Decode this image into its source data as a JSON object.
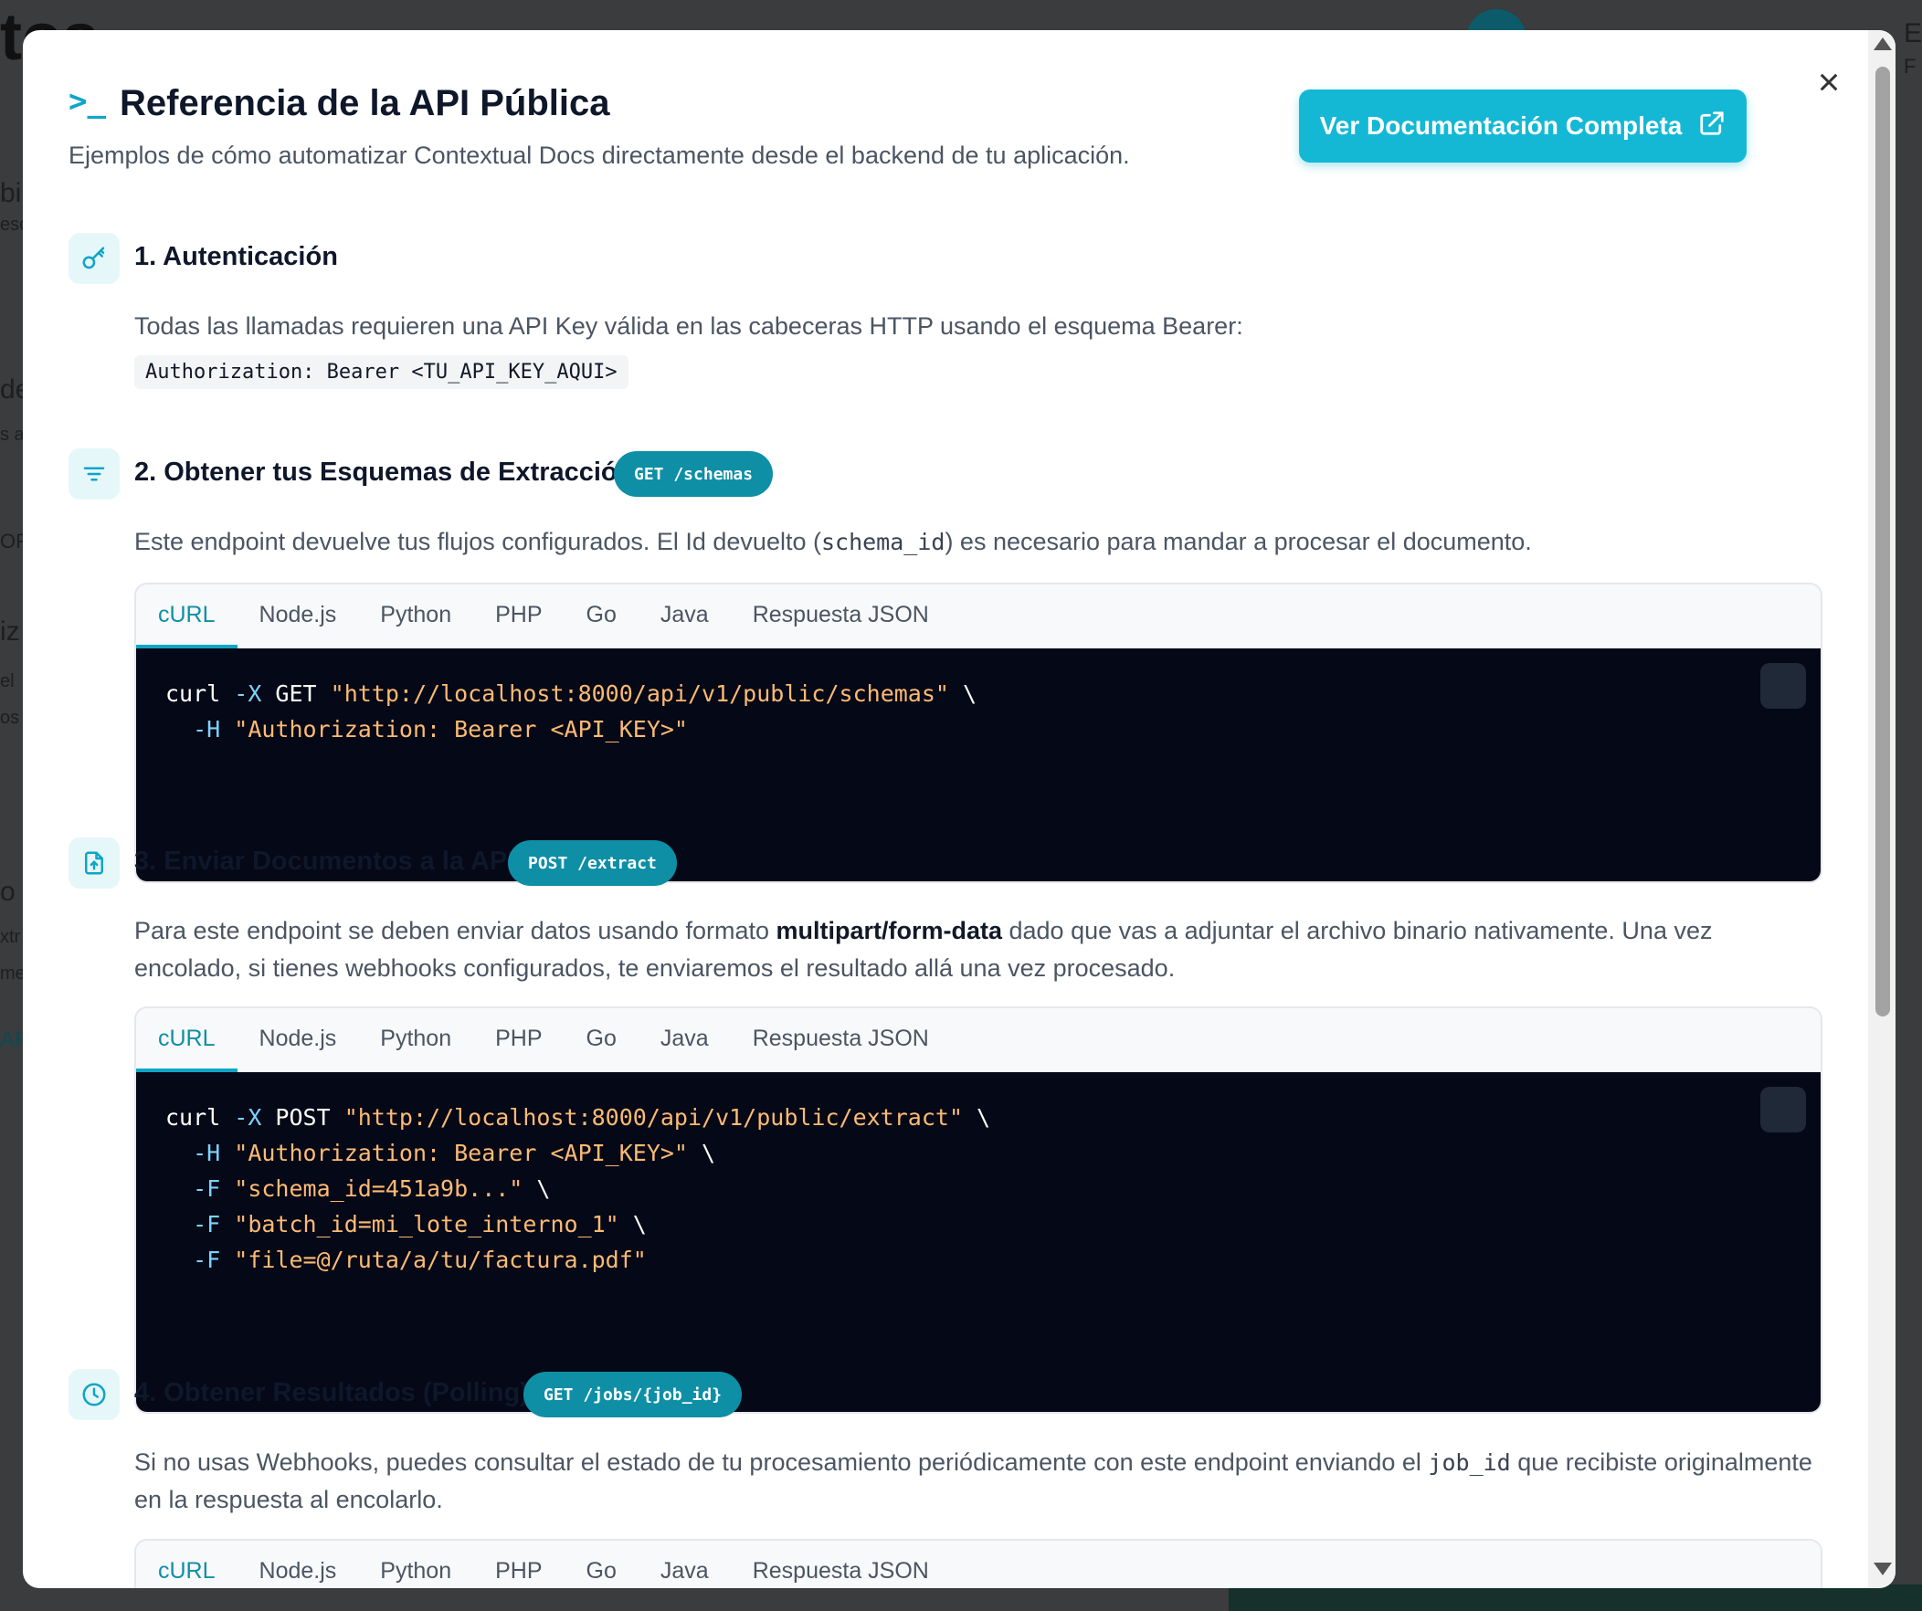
{
  "background": {
    "logo_fragment": "tos",
    "right_fragments": [
      "E",
      "F"
    ],
    "left_fragments": [
      "bir",
      "esc",
      "de",
      "s a",
      "OR",
      "iz",
      "el",
      "os",
      "o",
      "xtr",
      "me",
      "AP"
    ]
  },
  "modal": {
    "title": "Referencia de la API Pública",
    "subtitle": "Ejemplos de cómo automatizar Contextual Docs directamente desde el backend de tu aplicación.",
    "doc_button_label": "Ver Documentación Completa",
    "close_label": "×",
    "header_icon": "terminal-icon",
    "accent_color": "#14b8d4"
  },
  "sections": [
    {
      "title": "1. Autenticación",
      "icon": "key-icon",
      "description": "Todas las llamadas requieren una API Key válida en las cabeceras HTTP usando el esquema Bearer:",
      "code_inline": "Authorization: Bearer <TU_API_KEY_AQUI>"
    },
    {
      "title": "2. Obtener tus Esquemas de Extracción",
      "icon": "filter-icon",
      "badge": "GET /schemas",
      "desc_parts": [
        "Este endpoint devuelve tus flujos configurados. El Id devuelto (",
        "schema_id",
        ") es necesario para mandar a procesar el documento."
      ],
      "tabs": [
        "cURL",
        "Node.js",
        "Python",
        "PHP",
        "Go",
        "Java",
        "Respuesta JSON"
      ],
      "active_tab": "cURL",
      "code_lines": [
        {
          "indent": "",
          "cmd": "curl",
          "flag": " -X",
          "rest": " GET ",
          "str": "\"http://localhost:8000/api/v1/public/schemas\"",
          "bs": " \\"
        },
        {
          "indent": "  ",
          "cmd": "",
          "flag": "-H",
          "rest": " ",
          "str": "\"Authorization: Bearer <API_KEY>\"",
          "bs": ""
        }
      ]
    },
    {
      "title": "3. Enviar Documentos a la API",
      "icon": "file-upload-icon",
      "badge": "POST /extract",
      "desc_parts": [
        "Para este endpoint se deben enviar datos usando formato ",
        "multipart/form-data",
        " dado que vas a adjuntar el archivo binario nativamente. Una vez encolado, si tienes webhooks configurados, te enviaremos el resultado allá una vez procesado."
      ],
      "tabs": [
        "cURL",
        "Node.js",
        "Python",
        "PHP",
        "Go",
        "Java",
        "Respuesta JSON"
      ],
      "active_tab": "cURL",
      "code_lines": [
        {
          "indent": "",
          "cmd": "curl",
          "flag": " -X",
          "rest": " POST ",
          "str": "\"http://localhost:8000/api/v1/public/extract\"",
          "bs": " \\"
        },
        {
          "indent": "  ",
          "cmd": "",
          "flag": "-H",
          "rest": " ",
          "str": "\"Authorization: Bearer <API_KEY>\"",
          "bs": " \\"
        },
        {
          "indent": "  ",
          "cmd": "",
          "flag": "-F",
          "rest": " ",
          "str": "\"schema_id=451a9b...\"",
          "bs": " \\"
        },
        {
          "indent": "  ",
          "cmd": "",
          "flag": "-F",
          "rest": " ",
          "str": "\"batch_id=mi_lote_interno_1\"",
          "bs": " \\"
        },
        {
          "indent": "  ",
          "cmd": "",
          "flag": "-F",
          "rest": " ",
          "str": "\"file=@/ruta/a/tu/factura.pdf\"",
          "bs": ""
        }
      ]
    },
    {
      "title": "4. Obtener Resultados (Polling)",
      "icon": "clock-icon",
      "badge": "GET /jobs/{job_id}",
      "desc_parts": [
        "Si no usas Webhooks, puedes consultar el estado de tu procesamiento periódicamente con este endpoint enviando el ",
        "job_id",
        " que recibiste originalmente en la respuesta al encolarlo."
      ],
      "tabs": [
        "cURL",
        "Node.js",
        "Python",
        "PHP",
        "Go",
        "Java",
        "Respuesta JSON"
      ],
      "active_tab": "cURL"
    }
  ]
}
